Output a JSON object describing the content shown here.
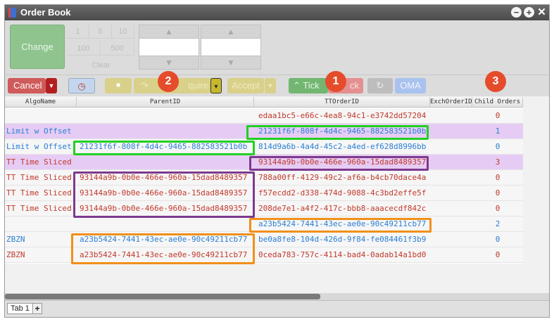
{
  "window": {
    "title": "Order Book"
  },
  "change": {
    "label": "Change"
  },
  "quantities": [
    "1",
    "5",
    "10",
    "100",
    "500"
  ],
  "clear_label": "Clear",
  "toolbar": {
    "cancel": "Cancel",
    "acquire": "quire",
    "accept": "Accept",
    "tick": "Tick",
    "unstick": "ck",
    "oma": "OMA"
  },
  "badges": [
    "1",
    "2",
    "3"
  ],
  "columns": [
    "AlgoName",
    "ParentID",
    "TTOrderID",
    "ExchOrderID",
    "Child Orders"
  ],
  "rows": [
    {
      "algo": "",
      "parent": "",
      "tt": "edaa1bc5-e66c-4ea8-94c1-e3742dd57204",
      "child": "0",
      "bg": "#f6f6f6",
      "color": "#c0392b"
    },
    {
      "algo": "Limit w Offset",
      "parent": "",
      "tt": "21231f6f-808f-4d4c-9465-882583521b0b",
      "child": "1",
      "bg": "#e6ccf4",
      "color": "#2a7fd4"
    },
    {
      "algo": "Limit w Offset",
      "parent": "21231f6f-808f-4d4c-9465-882583521b0b",
      "tt": "814d9a6b-4a4d-45c2-a4ed-ef628d8996bb",
      "child": "0",
      "bg": "#f6f6f6",
      "color": "#2a7fd4"
    },
    {
      "algo": "TT Time Sliced",
      "parent": "",
      "tt": "93144a9b-0b0e-466e-960a-15dad8489357",
      "child": "3",
      "bg": "#e6ccf4",
      "color": "#c0392b"
    },
    {
      "algo": "TT Time Sliced",
      "parent": "93144a9b-0b0e-466e-960a-15dad8489357",
      "tt": "788a00ff-4129-49c2-af6a-b4cb70dace4a",
      "child": "0",
      "bg": "#f6f6f6",
      "color": "#c0392b"
    },
    {
      "algo": "TT Time Sliced",
      "parent": "93144a9b-0b0e-466e-960a-15dad8489357",
      "tt": "f57ecdd2-d338-474d-9088-4c3bd2effe5f",
      "child": "0",
      "bg": "#f6f6f6",
      "color": "#c0392b"
    },
    {
      "algo": "TT Time Sliced",
      "parent": "93144a9b-0b0e-466e-960a-15dad8489357",
      "tt": "208de7e1-a4f2-417c-bbb8-aaacecdf842c",
      "child": "0",
      "bg": "#f6f6f6",
      "color": "#c0392b"
    },
    {
      "algo": "",
      "parent": "",
      "tt": "a23b5424-7441-43ec-ae0e-90c49211cb77",
      "child": "2",
      "bg": "#f6f6f6",
      "color": "#2a7fd4"
    },
    {
      "algo": "ZBZN",
      "parent": "a23b5424-7441-43ec-ae0e-90c49211cb77",
      "tt": "be0a8fe8-104d-426d-9f84-fe084461f3b9",
      "child": "0",
      "bg": "#f6f6f6",
      "color": "#2a7fd4"
    },
    {
      "algo": "ZBZN",
      "parent": "a23b5424-7441-43ec-ae0e-90c49211cb77",
      "tt": "0ceda783-757c-4114-bad4-0adab14a1bd0",
      "child": "0",
      "bg": "#f6f6f6",
      "color": "#c0392b"
    }
  ],
  "tabs": {
    "first": "Tab 1",
    "add": "+"
  },
  "colors": {
    "green_box": "#22d022",
    "purple_box": "#7d3a8e",
    "orange_box": "#f0901a"
  }
}
